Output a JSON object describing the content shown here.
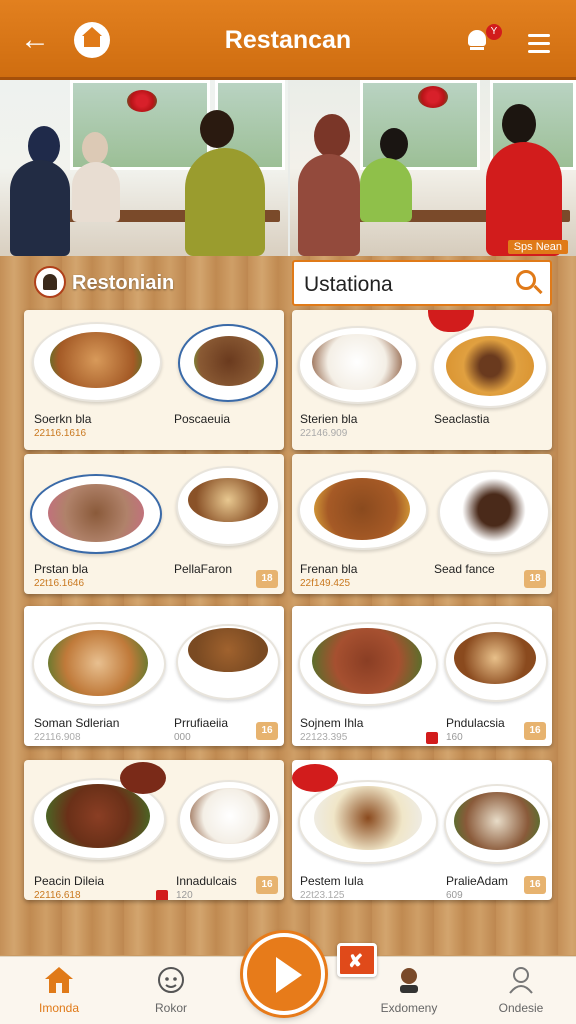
{
  "header": {
    "title": "Restancan",
    "notification_count": "Y"
  },
  "hero": {
    "tag": "Sps Nean"
  },
  "brand": {
    "name": "Restoniain"
  },
  "search": {
    "value": "Ustationa"
  },
  "cards": [
    {
      "left_name": "Soerkn bla",
      "left_price": "22116.1616",
      "right_name": "Poscaeuia",
      "right_sub": "",
      "num": ""
    },
    {
      "left_name": "Sterien bla",
      "left_price": "22146.909",
      "right_name": "Seaclastia",
      "right_sub": "",
      "num": ""
    },
    {
      "left_name": "Prstan bla",
      "left_price": "22t16.1646",
      "right_name": "PellaFaron",
      "right_sub": "",
      "num": "18"
    },
    {
      "left_name": "Frenan bla",
      "left_price": "22f149.425",
      "right_name": "Sead fance",
      "right_sub": "",
      "num": "18"
    },
    {
      "left_name": "Soman Sdlerian",
      "left_price": "22116.908",
      "right_name": "Prrufiaeiia",
      "right_sub": "000",
      "num": "16"
    },
    {
      "left_name": "Sojnem Ihla",
      "left_price": "22123.395",
      "right_name": "Pndulacsia",
      "right_sub": "160",
      "num": "16"
    },
    {
      "left_name": "Peacin Dileia",
      "left_price": "22116.618",
      "right_name": "Innadulcais",
      "right_sub": "120",
      "num": "16"
    },
    {
      "left_name": "Pestem Iula",
      "left_price": "22t23.125",
      "right_name": "PralieAdam",
      "right_sub": "609",
      "num": "16"
    }
  ],
  "nav": {
    "items": [
      {
        "label": "Imonda"
      },
      {
        "label": "Rokor"
      },
      {
        "label": "Exdomeny"
      },
      {
        "label": "Ondesie"
      }
    ]
  },
  "colors": {
    "accent": "#e07a18",
    "header": "#d8761a",
    "card_bg": "#fbf4e6"
  }
}
